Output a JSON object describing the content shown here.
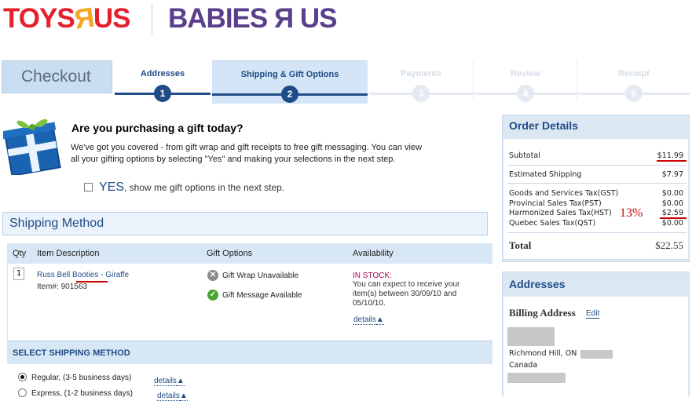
{
  "brand": {
    "toys_r_us": [
      "TOYS",
      "Я",
      "US"
    ],
    "babies_r_us": "BABIES Я US"
  },
  "checkout": {
    "title": "Checkout",
    "steps": [
      {
        "label": "Addresses",
        "num": "1"
      },
      {
        "label": "Shipping & Gift Options",
        "num": "2"
      },
      {
        "label": "Payments",
        "num": "3"
      },
      {
        "label": "Review",
        "num": "4"
      },
      {
        "label": "Receipt",
        "num": "5"
      }
    ]
  },
  "gift": {
    "title": "Are you purchasing a gift today?",
    "description": "We've got you covered - from gift wrap and gift receipts to free gift messaging. You can view all your gifting options by selecting \"Yes\" and making your selections in the next step.",
    "yes_label": "YES",
    "yes_suffix": ", show me gift options in the next step."
  },
  "shipping": {
    "title": "Shipping Method",
    "columns": [
      "Qty",
      "Item Description",
      "Gift Options",
      "Availability"
    ],
    "item": {
      "qty": "1",
      "name": "Russ Bell Booties - Giraffe",
      "item_number": "Item#: 901563",
      "gift_wrap": "Gift Wrap Unavailable",
      "gift_message": "Gift Message Available",
      "stock_status": "IN STOCK:",
      "availability": "You can expect to receive your item(s) between 30/09/10 and 05/10/10.",
      "details_label": "details"
    },
    "select_method_title": "SELECT SHIPPING METHOD",
    "methods": [
      {
        "label": "Regular, (3-5 business days)",
        "details": "details",
        "selected": true
      },
      {
        "label": "Express, (1-2 business days)",
        "details": "details",
        "selected": false
      }
    ]
  },
  "order_details": {
    "title": "Order Details",
    "subtotal_label": "Subtotal",
    "subtotal": "$11.99",
    "est_shipping_label": "Estimated Shipping",
    "est_shipping": "$7.97",
    "gst_label": "Goods and Services Tax(GST)",
    "gst": "$0.00",
    "pst_label": "Provincial Sales Tax(PST)",
    "pst": "$0.00",
    "hst_label": "Harmonized Sales Tax(HST)",
    "hst": "$2.59",
    "qst_label": "Quebec Sales Tax(QST)",
    "qst": "$0.00",
    "total_label": "Total",
    "total": "$22.55",
    "annotation": "13%"
  },
  "addresses": {
    "title": "Addresses",
    "billing_title": "Billing Address",
    "edit_label": "Edit",
    "city": "Richmond Hill, ON",
    "country": "Canada"
  },
  "colors": {
    "accent_blue": "#1f4c86",
    "panel_blue": "#dbe8f4",
    "annotation_red": "#cc0000",
    "stock_magenta": "#a8004e"
  }
}
